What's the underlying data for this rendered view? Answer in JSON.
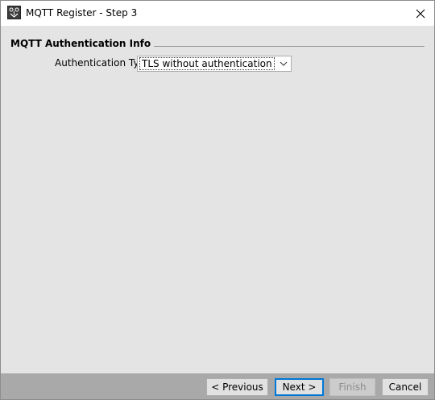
{
  "window": {
    "title": "MQTT Register - Step 3",
    "app_icon": "mqtt-app-icon",
    "close_icon": "close-icon"
  },
  "group": {
    "title": "MQTT Authentication Info"
  },
  "form": {
    "auth_type_label": "Authentication Type:",
    "auth_type_value": "TLS without authentication",
    "auth_type_icon": "chevron-down-icon"
  },
  "footer": {
    "previous_label": "< Previous",
    "next_label": "Next >",
    "finish_label": "Finish",
    "cancel_label": "Cancel"
  },
  "colors": {
    "window_background": "#e4e4e4",
    "footer_background": "#a9a9a9",
    "default_button_border": "#0078d7",
    "disabled_text": "#8d8d8d"
  }
}
